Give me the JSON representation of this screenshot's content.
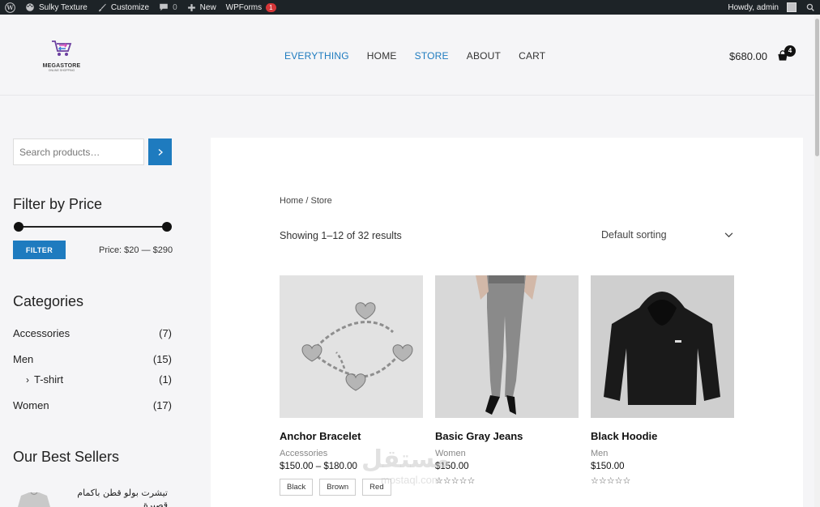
{
  "adminbar": {
    "site_name": "Sulky Texture",
    "customize": "Customize",
    "comments_count": "0",
    "new_label": "New",
    "wpforms_label": "WPForms",
    "wpforms_badge": "1",
    "howdy": "Howdy, admin"
  },
  "header": {
    "logo_text": "MEGASTORE",
    "logo_sub": "ONLINE SHOPPING",
    "nav": [
      "EVERYTHING",
      "HOME",
      "STORE",
      "ABOUT",
      "CART"
    ],
    "cart_total": "$680.00",
    "cart_count": "4"
  },
  "sidebar": {
    "search_placeholder": "Search products…",
    "filter_title": "Filter by Price",
    "filter_button": "FILTER",
    "price_range": "Price: $20 — $290",
    "categories_title": "Categories",
    "categories": [
      {
        "name": "Accessories",
        "count": "(7)"
      },
      {
        "name": "Men",
        "count": "(15)"
      },
      {
        "name": "T-shirt",
        "count": "(1)"
      },
      {
        "name": "Women",
        "count": "(17)"
      }
    ],
    "best_sellers_title": "Our Best Sellers",
    "best_seller_item": "تيشرت بولو قطن باكمام قصيرة"
  },
  "main": {
    "breadcrumb": "Home / Store",
    "result_count": "Showing 1–12 of 32 results",
    "sorting": "Default sorting",
    "products": [
      {
        "title": "Anchor Bracelet",
        "category": "Accessories",
        "price": "$150.00 – $180.00",
        "swatches": [
          "Black",
          "Brown",
          "Red"
        ]
      },
      {
        "title": "Basic Gray Jeans",
        "category": "Women",
        "price": "$150.00",
        "stars": "☆☆☆☆☆"
      },
      {
        "title": "Black Hoodie",
        "category": "Men",
        "price": "$150.00",
        "stars": "☆☆☆☆☆"
      }
    ]
  },
  "watermark": {
    "text": "مستقل",
    "sub": "mostaql.com"
  },
  "colors": {
    "accent": "#1e7bbf",
    "adminbar": "#1d2327",
    "badge": "#d63638"
  },
  "icons": [
    "wordpress-icon",
    "palette-icon",
    "brush-icon",
    "comment-icon",
    "plus-icon",
    "search-icon",
    "chevron-right-icon",
    "chevron-down-icon",
    "cart-icon",
    "star-icon"
  ]
}
